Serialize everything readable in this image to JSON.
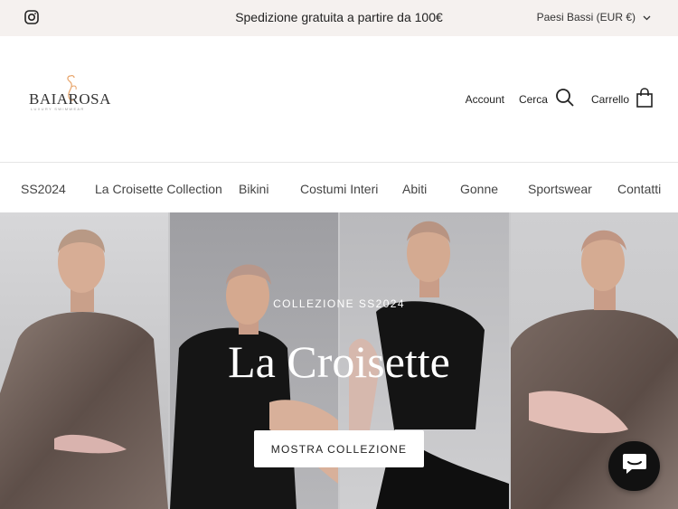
{
  "announcement": {
    "message": "Spedizione gratuita a partire da 100€",
    "country_selector": "Paesi Bassi (EUR €)"
  },
  "logo": {
    "wordmark": "BAIAROSA",
    "tagline": "LUXURY SWIMWEAR"
  },
  "header_links": {
    "account": "Account",
    "search": "Cerca",
    "cart": "Carrello"
  },
  "nav": {
    "items": [
      {
        "label": "SS2024"
      },
      {
        "label": "La Croisette Collection"
      },
      {
        "label": "Bikini"
      },
      {
        "label": "Costumi Interi"
      },
      {
        "label": "Abiti"
      },
      {
        "label": "Gonne"
      },
      {
        "label": "Sportswear"
      },
      {
        "label": "Contatti"
      }
    ]
  },
  "hero": {
    "subtitle": "COLLEZIONE SS2024",
    "title": "La Croisette",
    "button": "MOSTRA COLLEZIONE"
  },
  "icons": {
    "instagram": "instagram-icon",
    "chevron": "chevron-down-icon",
    "search": "search-icon",
    "cart": "shopping-bag-icon",
    "chat": "chat-icon",
    "logo": "flamingo-logo-icon"
  },
  "colors": {
    "announcement_bg": "#f5f1ef",
    "logo_accent": "#e8a46a",
    "chat_bg": "#111111"
  }
}
